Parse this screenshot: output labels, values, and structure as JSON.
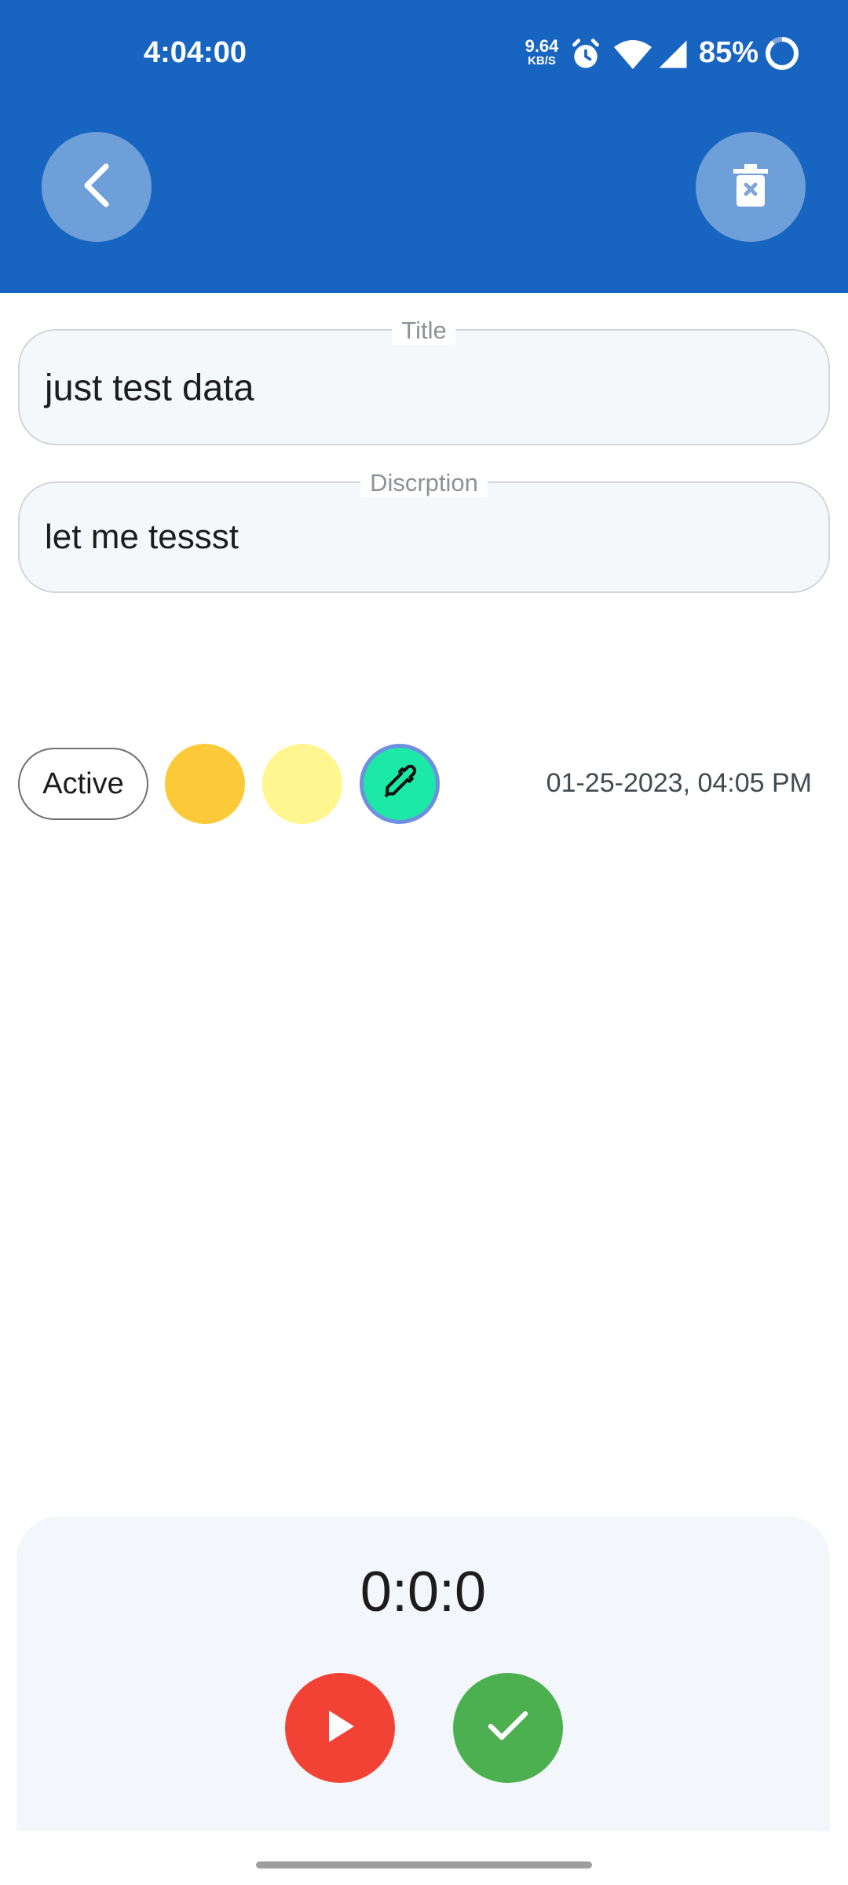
{
  "status_bar": {
    "time": "4:04:00",
    "net_speed_value": "9.64",
    "net_speed_unit": "KB/S",
    "battery_percent": "85%"
  },
  "header": {
    "back_icon": "chevron-left-icon",
    "delete_icon": "trash-x-icon"
  },
  "form": {
    "title_label": "Title",
    "title_value": "just test data",
    "description_label": "Discrption",
    "description_value": "let me tessst"
  },
  "options": {
    "status_chip": "Active",
    "colors": [
      "#fcca38",
      "#fff68f",
      "#1de9a6"
    ],
    "datetime": "01-25-2023, 04:05 PM"
  },
  "timer": {
    "display": "0:0:0",
    "play_icon": "play-icon",
    "done_icon": "check-icon"
  },
  "theme": {
    "primary": "#1865c1",
    "play": "#f24236",
    "done": "#4caf50"
  }
}
